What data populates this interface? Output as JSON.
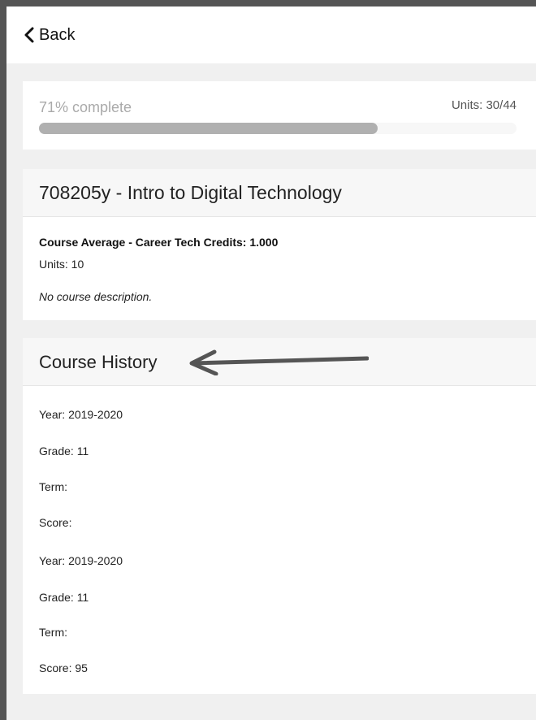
{
  "header": {
    "back_label": "Back"
  },
  "progress": {
    "percent_label": "71% complete",
    "percent_value": 0.71,
    "units_label": "Units: 30/44"
  },
  "course": {
    "title": "708205y - Intro to Digital Technology",
    "average_line": "Course Average - Career Tech Credits: 1.000",
    "units_line": "Units: 10",
    "description": "No course description."
  },
  "history": {
    "title": "Course History",
    "entries": [
      {
        "year": "Year: 2019-2020",
        "grade": "Grade: 11",
        "term": "Term:",
        "score": "Score:"
      },
      {
        "year": "Year: 2019-2020",
        "grade": "Grade: 11",
        "term": "Term:",
        "score": "Score: 95"
      }
    ]
  },
  "colors": {
    "progress_fill": "#b0b0b0",
    "card_header_bg": "#f7f7f7",
    "page_bg": "#f0f0f0",
    "annotation_arrow": "#555555"
  },
  "icons": {
    "back": "chevron-left-icon",
    "annotation": "arrow-left-icon"
  }
}
